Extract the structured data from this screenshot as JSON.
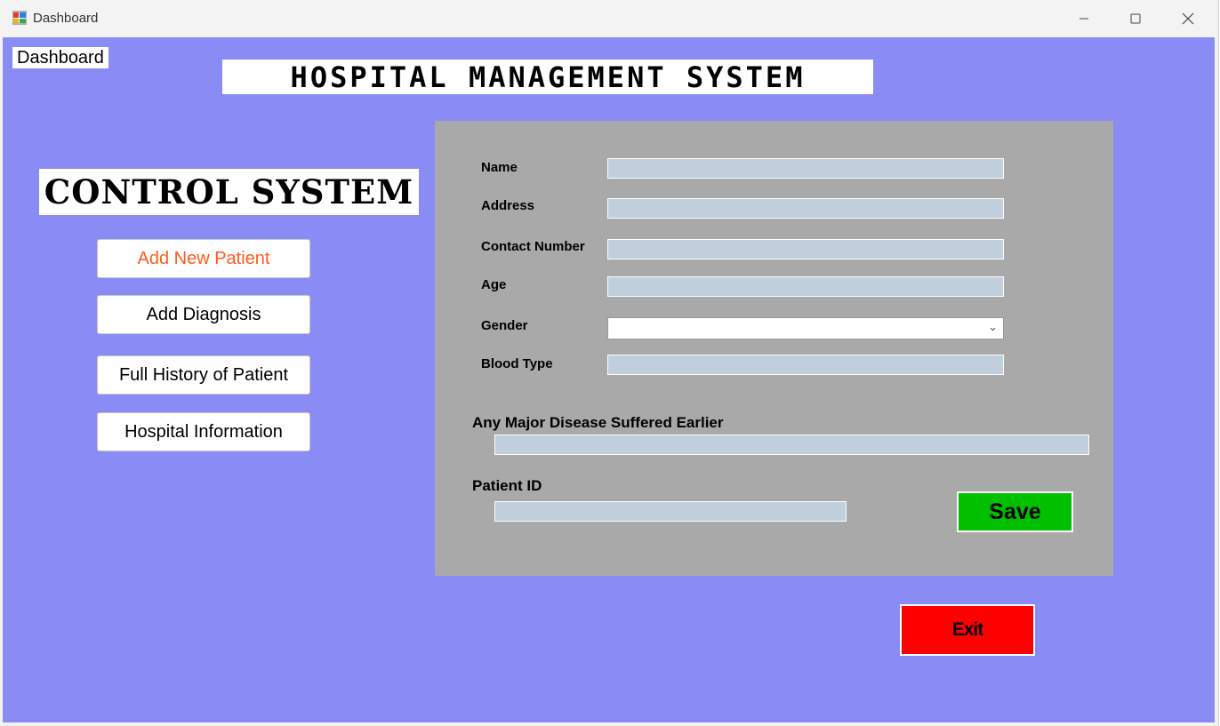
{
  "window": {
    "title": "Dashboard",
    "icon": "app-form-icon",
    "controls": [
      "minimize-icon",
      "maximize-icon",
      "close-icon"
    ]
  },
  "header": {
    "dashboard_label": "Dashboard",
    "main_title": "HOSPITAL MANAGEMENT SYSTEM",
    "control_title": "CONTROL SYSTEM"
  },
  "nav": {
    "items": [
      {
        "label": "Add New Patient",
        "active": true
      },
      {
        "label": "Add Diagnosis",
        "active": false
      },
      {
        "label": "Full History of Patient",
        "active": false
      },
      {
        "label": "Hospital Information",
        "active": false
      }
    ]
  },
  "form": {
    "name_label": "Name",
    "name_value": "",
    "address_label": "Address",
    "address_value": "",
    "contact_label": "Contact Number",
    "contact_value": "",
    "age_label": "Age",
    "age_value": "",
    "gender_label": "Gender",
    "gender_value": "",
    "blood_label": "Blood Type",
    "blood_value": "",
    "disease_label": "Any Major Disease Suffered Earlier",
    "disease_value": "",
    "patient_id_label": "Patient ID",
    "patient_id_value": "",
    "save_label": "Save"
  },
  "footer": {
    "exit_label": "Exit"
  },
  "colors": {
    "background": "#8b8bf5",
    "panel": "#a9a9a9",
    "input": "#c1cedc",
    "save": "#00c000",
    "exit": "#ff0000",
    "active_nav_text": "#ff5a1f"
  }
}
